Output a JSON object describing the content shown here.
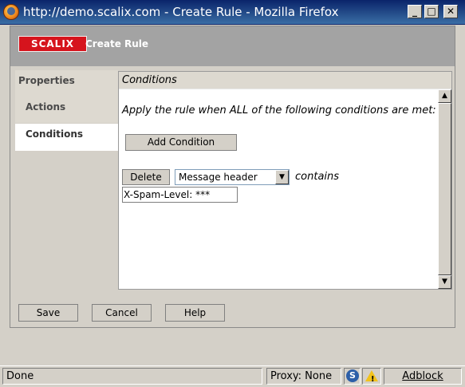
{
  "window": {
    "title": "http://demo.scalix.com - Create Rule - Mozilla Firefox",
    "minimize_glyph": "_",
    "maximize_glyph": "□",
    "close_glyph": "✕"
  },
  "header": {
    "logo_text": "SCALIX",
    "title": "Create Rule"
  },
  "nav": {
    "items": [
      {
        "label": "Properties"
      },
      {
        "label": "Actions"
      },
      {
        "label": "Conditions"
      }
    ]
  },
  "conditions": {
    "heading": "Conditions",
    "rule_text": "Apply the rule when ALL of the following conditions are met:",
    "add_label": "Add Condition",
    "delete_label": "Delete",
    "field_selected": "Message header",
    "operator_text": "contains",
    "value": "X-Spam-Level: ***"
  },
  "footer": {
    "save_label": "Save",
    "cancel_label": "Cancel",
    "help_label": "Help"
  },
  "statusbar": {
    "status": "Done",
    "proxy": "Proxy: None",
    "s_icon_letter": "S",
    "adblock": "Adblock"
  },
  "icons": {
    "browser": "firefox-icon",
    "dropdown": "chevron-down-icon",
    "scroll_up": "arrow-up-icon",
    "scroll_down": "arrow-down-icon",
    "warning": "warning-icon"
  },
  "colors": {
    "brand_red": "#d6141d",
    "header_gray": "#a3a3a3",
    "titlebar_blue": "#0a246a"
  }
}
